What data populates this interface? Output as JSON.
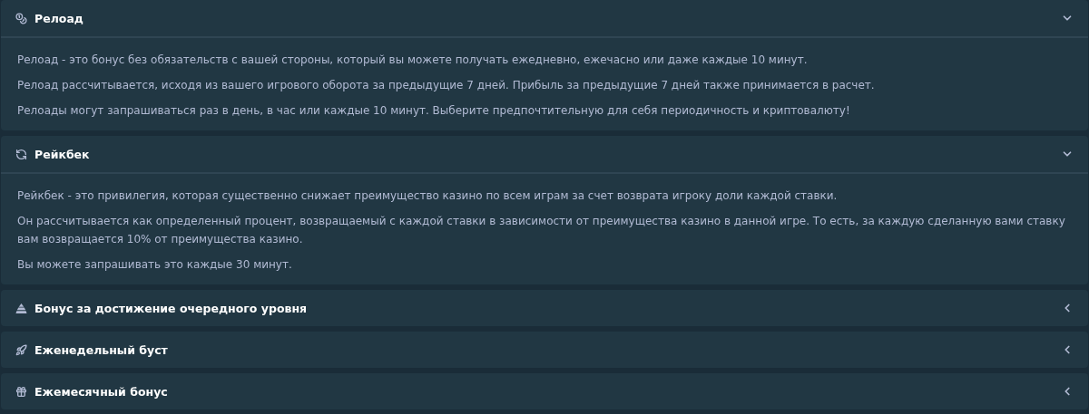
{
  "sections": [
    {
      "title": "Релоад",
      "kind": "reload",
      "expanded": true,
      "paragraphs": [
        "Релоад - это бонус без обязательств с вашей стороны, который вы можете получать ежедневно, ежечасно или даже каждые 10 минут.",
        "Релоад рассчитывается, исходя из вашего игрового оборота за предыдущие 7 дней. Прибыль за предыдущие 7 дней также принимается в расчет.",
        "Релоады могут запрашиваться раз в день, в час или каждые 10 минут. Выберите предпочтительную для себя периодичность и криптовалюту!"
      ]
    },
    {
      "title": "Рейкбек",
      "kind": "rakeback",
      "expanded": true,
      "paragraphs": [
        "Рейкбек - это привилегия, которая существенно снижает преимущество казино по всем играм за счет возврата игроку доли каждой ставки.",
        "Он рассчитывается как определенный процент, возвращаемый с каждой ставки в зависимости от преимущества казино в данной игре. То есть, за каждую сделанную вами ставку вам возвращается 10% от преимущества казино.",
        "Вы можете запрашивать это каждые 30 минут."
      ]
    },
    {
      "title": "Бонус за достижение очередного уровня",
      "kind": "level",
      "expanded": false
    },
    {
      "title": "Еженедельный буст",
      "kind": "boost",
      "expanded": false
    },
    {
      "title": "Ежемесячный бонус",
      "kind": "monthly",
      "expanded": false
    }
  ]
}
